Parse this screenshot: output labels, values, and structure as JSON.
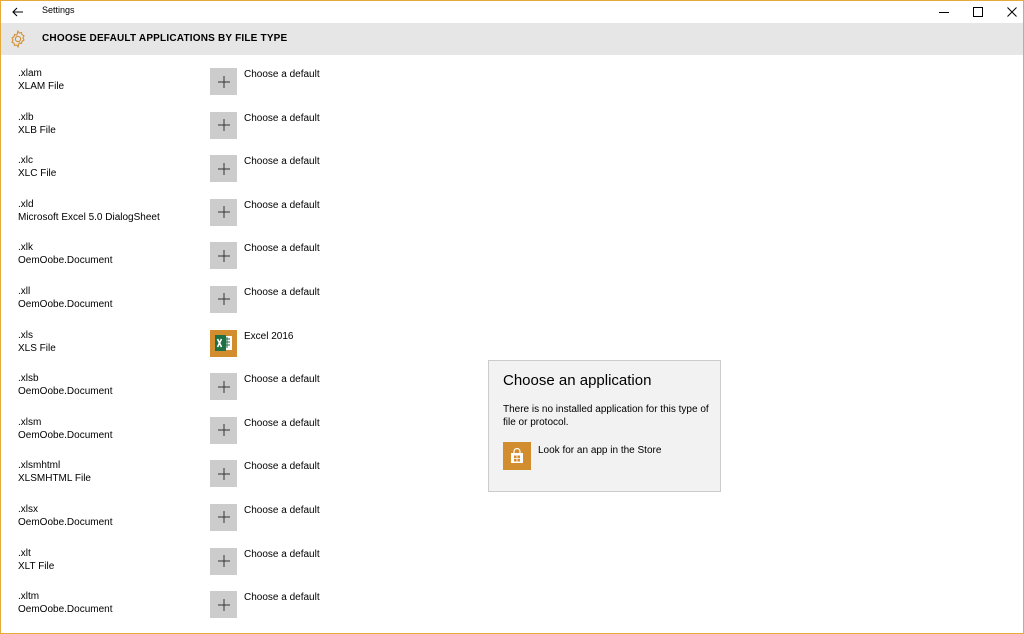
{
  "window": {
    "title": "Settings",
    "border_color": "#e8a93b"
  },
  "header": {
    "title": "CHOOSE DEFAULT APPLICATIONS BY FILE TYPE",
    "icon": "gear-icon",
    "accent": "#d28d2f"
  },
  "file_types": [
    {
      "ext": ".xlam",
      "desc": "XLAM File",
      "app": "Choose a default",
      "has_app": false
    },
    {
      "ext": ".xlb",
      "desc": "XLB File",
      "app": "Choose a default",
      "has_app": false
    },
    {
      "ext": ".xlc",
      "desc": "XLC File",
      "app": "Choose a default",
      "has_app": false
    },
    {
      "ext": ".xld",
      "desc": "Microsoft Excel 5.0 DialogSheet",
      "app": "Choose a default",
      "has_app": false
    },
    {
      "ext": ".xlk",
      "desc": "OemOobe.Document",
      "app": "Choose a default",
      "has_app": false
    },
    {
      "ext": ".xll",
      "desc": "OemOobe.Document",
      "app": "Choose a default",
      "has_app": false
    },
    {
      "ext": ".xls",
      "desc": "XLS File",
      "app": "Excel 2016",
      "has_app": true,
      "icon": "excel-icon"
    },
    {
      "ext": ".xlsb",
      "desc": "OemOobe.Document",
      "app": "Choose a default",
      "has_app": false
    },
    {
      "ext": ".xlsm",
      "desc": "OemOobe.Document",
      "app": "Choose a default",
      "has_app": false
    },
    {
      "ext": ".xlsmhtml",
      "desc": "XLSMHTML File",
      "app": "Choose a default",
      "has_app": false
    },
    {
      "ext": ".xlsx",
      "desc": "OemOobe.Document",
      "app": "Choose a default",
      "has_app": false
    },
    {
      "ext": ".xlt",
      "desc": "XLT File",
      "app": "Choose a default",
      "has_app": false
    },
    {
      "ext": ".xltm",
      "desc": "OemOobe.Document",
      "app": "Choose a default",
      "has_app": false
    }
  ],
  "flyout": {
    "title": "Choose an application",
    "message": "There is no installed application for this type of file or protocol.",
    "store_link": "Look for an app in the Store",
    "store_icon": "store-icon"
  }
}
